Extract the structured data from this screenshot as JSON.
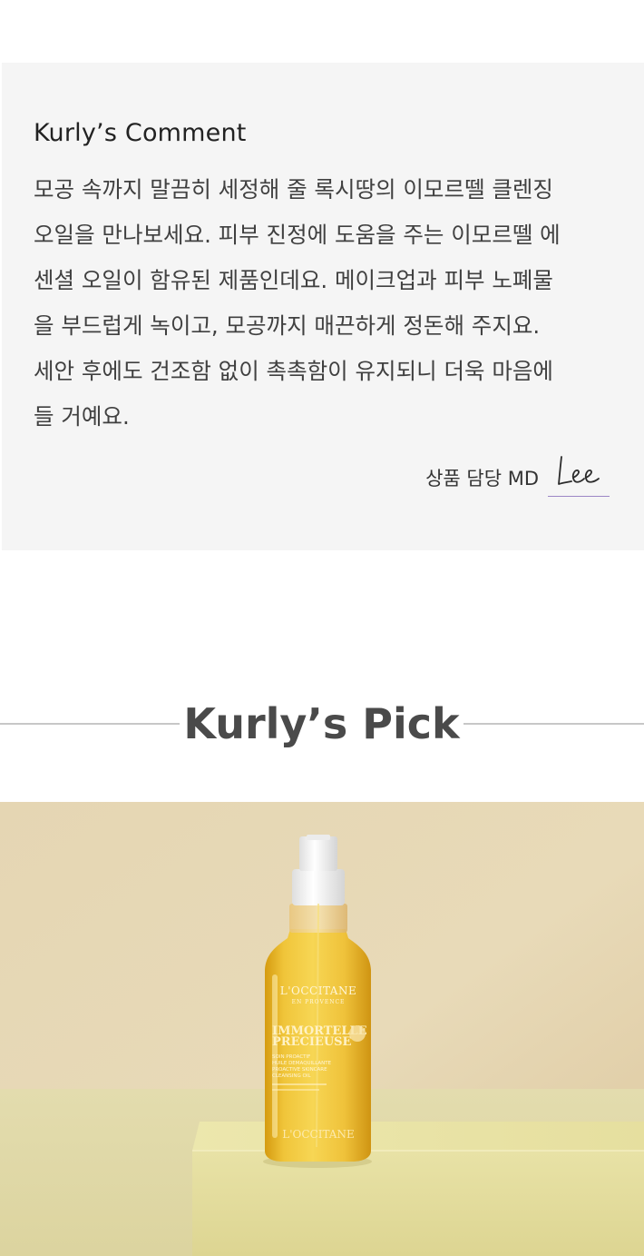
{
  "comment": {
    "title": "Kurly’s Comment",
    "lines": [
      "모공 속까지 말끔히 세정해 줄 록시땅의 이모르뗄 클렌징",
      "오일을 만나보세요. 피부 진정에 도움을 주는 이모르뗄 에",
      "센셜 오일이 함유된 제품인데요. 메이크업과 피부 노폐물",
      "을 부드럽게 녹이고, 모공까지 매끈하게 정돈해 주지요.",
      "세안 후에도 건조함 없이 촉촉함이 유지되니 더욱 마음에",
      "들 거예요."
    ],
    "md_label": "상품 담당 MD",
    "signature": "Lee"
  },
  "pick": {
    "title": "Kurly’s Pick"
  },
  "product_photo": {
    "brand": "L'OCCITANE",
    "brand_sub": "EN PROVENCE",
    "line1": "IMMORTELLE",
    "line2": "PRECIEUSE",
    "desc": [
      "SOIN PROACTIF",
      "HUILE DEMAQUILLANTE",
      "PROACTIVE SKINCARE",
      "CLEANSING OIL"
    ],
    "base_brand": "L'OCCITANE"
  },
  "colors": {
    "comment_bg": "#f5f5f5",
    "signature_line": "#9b86c5",
    "rule": "#c7c7c7",
    "heading": "#4a4a4a"
  }
}
